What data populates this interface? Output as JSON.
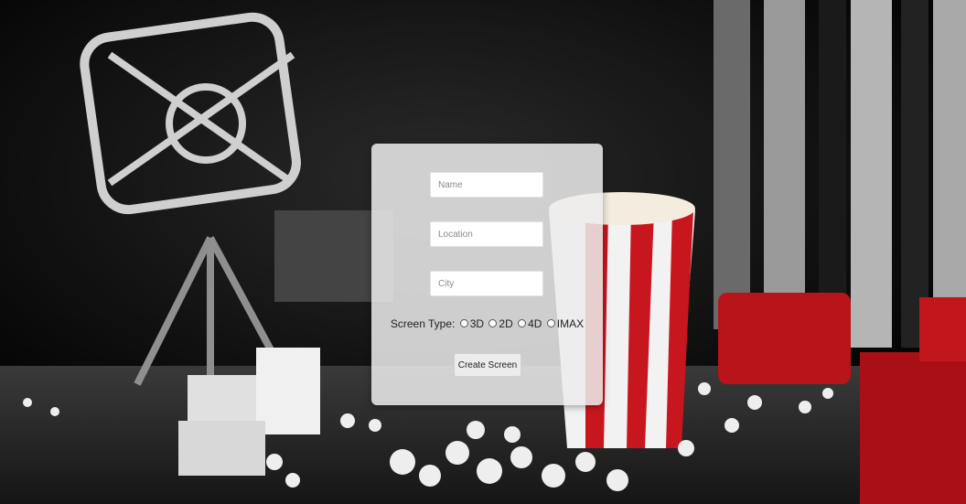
{
  "form": {
    "name_placeholder": "Name",
    "location_placeholder": "Location",
    "city_placeholder": "City",
    "screen_type_label": "Screen Type:",
    "screen_type_options": [
      "3D",
      "2D",
      "4D",
      "IMAX"
    ],
    "submit_label": "Create Screen"
  },
  "background": {
    "description_icons": [
      "film-projector-icon",
      "popcorn-bucket-icon"
    ],
    "accent_color": "#c8161e"
  }
}
